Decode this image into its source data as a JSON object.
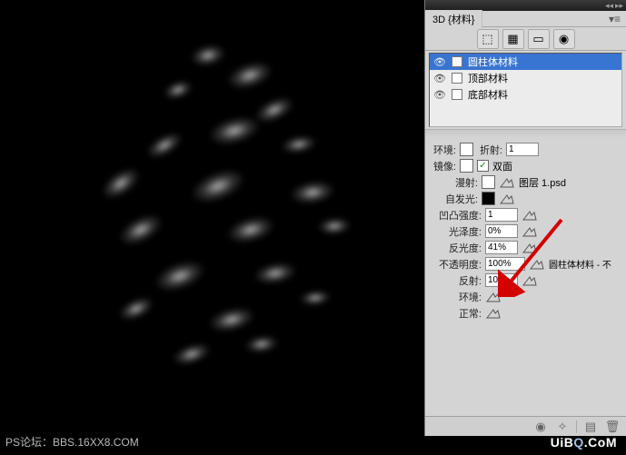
{
  "footer": {
    "left": "PS论坛：BBS.16XX8.COM",
    "right_1": "UiB",
    "right_2": "Q",
    "right_3": ".CoM"
  },
  "panel": {
    "tab": "3D {材料}",
    "modes": {
      "m1": "⬚",
      "m2": "▦",
      "m3": "▭",
      "m4": "◉"
    },
    "materials": [
      {
        "name": "圆柱体材料",
        "selected": true
      },
      {
        "name": "顶部材料",
        "selected": false
      },
      {
        "name": "底部材料",
        "selected": false
      }
    ],
    "props": {
      "env_label": "环境:",
      "refract_label": "折射:",
      "refract_value": "1",
      "mirror_label": "镜像:",
      "double_face_label": "双面",
      "diffuse_label": "漫射:",
      "diffuse_file": "图层 1.psd",
      "emissive_label": "自发光:",
      "bump_label": "凹凸强度:",
      "bump_value": "1",
      "gloss_label": "光泽度:",
      "gloss_value": "0%",
      "shine_label": "反光度:",
      "shine_value": "41%",
      "opacity_label": "不透明度:",
      "opacity_value": "100%",
      "opacity_file": "圆柱体材料 - 不",
      "reflect_label": "反射:",
      "reflect_value": "100",
      "env2_label": "环境:",
      "normal_label": "正常:"
    }
  }
}
